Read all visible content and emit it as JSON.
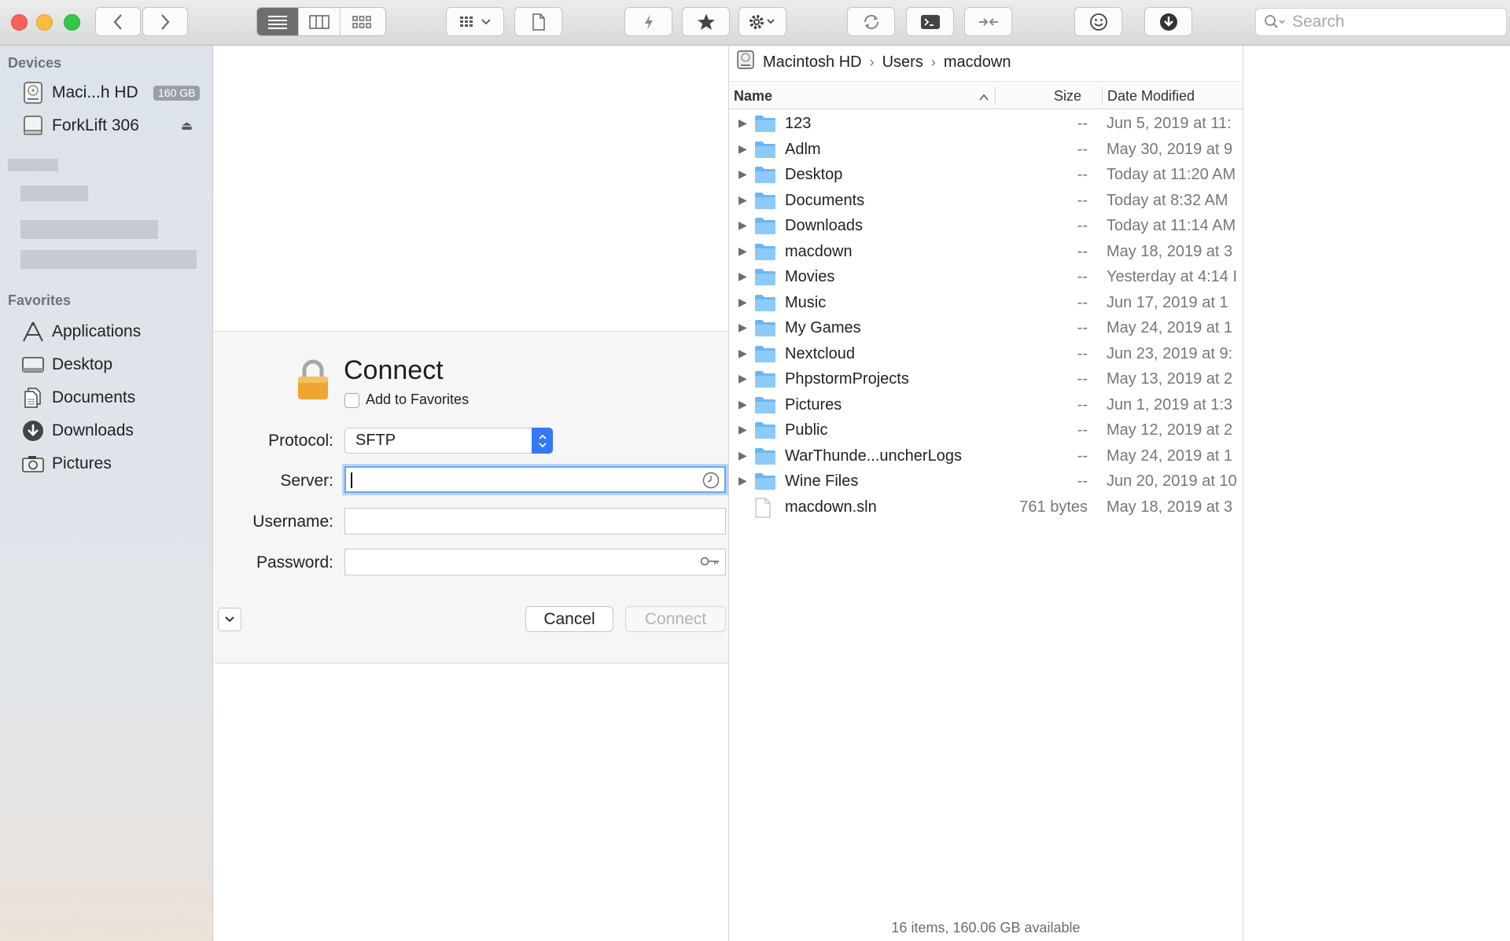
{
  "toolbar": {
    "search_placeholder": "Search",
    "view_modes": [
      "list-view-icon",
      "column-view-icon",
      "icon-view-icon"
    ]
  },
  "sidebar": {
    "devices_heading": "Devices",
    "devices": [
      {
        "label": "Maci...h HD",
        "badge": "160 GB",
        "icon": "hard-drive-icon"
      },
      {
        "label": "ForkLift 306",
        "icon": "disk-image-icon"
      }
    ],
    "favorites_heading": "Favorites",
    "favorites": [
      {
        "label": "Applications",
        "icon": "applications-icon"
      },
      {
        "label": "Desktop",
        "icon": "desktop-icon"
      },
      {
        "label": "Documents",
        "icon": "documents-icon"
      },
      {
        "label": "Downloads",
        "icon": "downloads-icon"
      },
      {
        "label": "Pictures",
        "icon": "pictures-icon"
      }
    ]
  },
  "connect": {
    "title": "Connect",
    "add_to_favorites": "Add to Favorites",
    "protocol_label": "Protocol:",
    "protocol_value": "SFTP",
    "server_label": "Server:",
    "server_value": "",
    "username_label": "Username:",
    "username_value": "",
    "password_label": "Password:",
    "password_value": "",
    "cancel_label": "Cancel",
    "connect_label": "Connect"
  },
  "browser": {
    "path": [
      "Macintosh HD",
      "Users",
      "macdown"
    ],
    "columns": {
      "name": "Name",
      "size": "Size",
      "date": "Date Modified"
    },
    "rows": [
      {
        "name": "123",
        "size": "--",
        "date": "Jun 5, 2019 at 11:",
        "kind": "folder"
      },
      {
        "name": "Adlm",
        "size": "--",
        "date": "May 30, 2019 at 9",
        "kind": "folder"
      },
      {
        "name": "Desktop",
        "size": "--",
        "date": "Today at 11:20 AM",
        "kind": "folder"
      },
      {
        "name": "Documents",
        "size": "--",
        "date": "Today at 8:32 AM",
        "kind": "folder"
      },
      {
        "name": "Downloads",
        "size": "--",
        "date": "Today at 11:14 AM",
        "kind": "folder"
      },
      {
        "name": "macdown",
        "size": "--",
        "date": "May 18, 2019 at 3",
        "kind": "folder"
      },
      {
        "name": "Movies",
        "size": "--",
        "date": "Yesterday at 4:14 I",
        "kind": "folder"
      },
      {
        "name": "Music",
        "size": "--",
        "date": "Jun 17, 2019 at 1",
        "kind": "folder"
      },
      {
        "name": "My Games",
        "size": "--",
        "date": "May 24, 2019 at 1",
        "kind": "folder"
      },
      {
        "name": "Nextcloud",
        "size": "--",
        "date": "Jun 23, 2019 at 9:",
        "kind": "folder"
      },
      {
        "name": "PhpstormProjects",
        "size": "--",
        "date": "May 13, 2019 at 2",
        "kind": "folder"
      },
      {
        "name": "Pictures",
        "size": "--",
        "date": "Jun 1, 2019 at 1:3",
        "kind": "folder"
      },
      {
        "name": "Public",
        "size": "--",
        "date": "May 12, 2019 at 2",
        "kind": "folder"
      },
      {
        "name": "WarThunde...uncherLogs",
        "size": "--",
        "date": "May 24, 2019 at 1",
        "kind": "folder"
      },
      {
        "name": "Wine Files",
        "size": "--",
        "date": "Jun 20, 2019 at 10",
        "kind": "folder"
      },
      {
        "name": "macdown.sln",
        "size": "761 bytes",
        "date": "May 18, 2019 at 3",
        "kind": "file"
      }
    ],
    "status": "16 items, 160.06 GB available"
  },
  "colors": {
    "accent": "#3478f6",
    "folder": "#6cb6f0",
    "focus_ring": "#b8d3f8"
  }
}
